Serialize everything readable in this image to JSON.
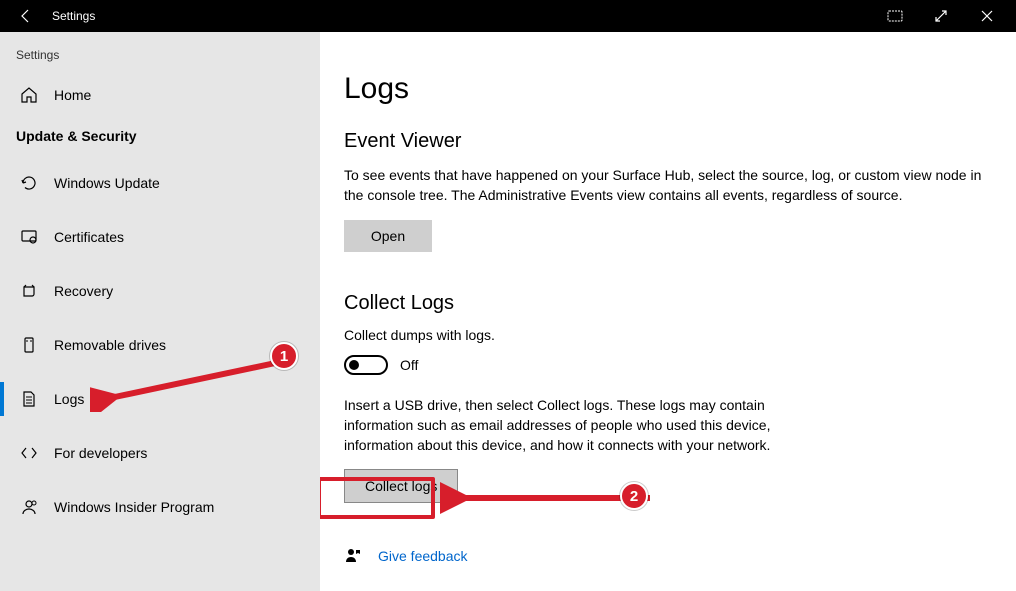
{
  "titlebar": {
    "title": "Settings"
  },
  "sidebar": {
    "top_label": "Settings",
    "home_label": "Home",
    "section_title": "Update & Security",
    "items": [
      {
        "label": "Windows Update"
      },
      {
        "label": "Certificates"
      },
      {
        "label": "Recovery"
      },
      {
        "label": "Removable drives"
      },
      {
        "label": "Logs"
      },
      {
        "label": "For developers"
      },
      {
        "label": "Windows Insider Program"
      }
    ]
  },
  "content": {
    "page_title": "Logs",
    "event_viewer": {
      "title": "Event Viewer",
      "desc": "To see events that have happened on your Surface Hub, select the source, log, or custom view node in the console tree. The Administrative Events view contains all events, regardless of source.",
      "open_btn": "Open"
    },
    "collect_logs": {
      "title": "Collect Logs",
      "dumps_label": "Collect dumps with logs.",
      "toggle_state": "Off",
      "desc": "Insert a USB drive, then select Collect logs. These logs may contain information such as email addresses of people who used this device, information about this device, and how it connects with your network.",
      "collect_btn": "Collect logs"
    },
    "feedback": "Give feedback"
  },
  "annotations": {
    "badge1": "1",
    "badge2": "2"
  }
}
